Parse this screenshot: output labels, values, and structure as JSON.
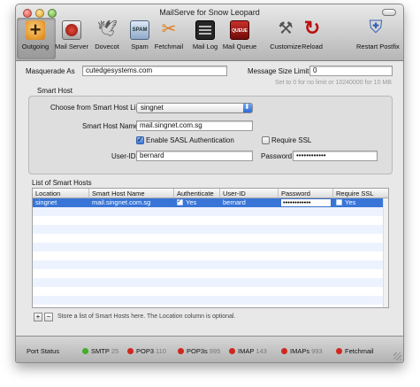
{
  "window": {
    "title": "MailServe for Snow Leopard"
  },
  "toolbar": {
    "items": [
      {
        "label": "Outgoing",
        "icon": "plus-icon"
      },
      {
        "label": "Mail Server",
        "icon": "mail-server-icon"
      },
      {
        "label": "Dovecot",
        "icon": "dove-icon"
      },
      {
        "label": "Spam",
        "icon": "spam-icon"
      },
      {
        "label": "Fetchmail",
        "icon": "fetchmail-icon"
      },
      {
        "label": "Mail Log",
        "icon": "log-icon"
      },
      {
        "label": "Mail Queue",
        "icon": "queue-icon"
      },
      {
        "label": "Customize",
        "icon": "tools-icon"
      },
      {
        "label": "Reload",
        "icon": "reload-icon"
      },
      {
        "label": "Restart Postfix",
        "icon": "shield-icon"
      }
    ],
    "selected": "Outgoing"
  },
  "masquerade": {
    "label": "Masquerade As",
    "value": "cutedgesystems.com"
  },
  "size_limit": {
    "label": "Message Size Limit",
    "value": "0",
    "hint": "Set to 0 for no limit or 10240000 for 10 MB"
  },
  "smart_host": {
    "group_label": "Smart Host",
    "choose_label": "Choose from Smart Host List",
    "choose_value": "singnet",
    "name_label": "Smart Host Name",
    "name_value": "mail.singnet.com.sg",
    "sasl_label": "Enable SASL Authentication",
    "sasl_checked": true,
    "ssl_label": "Require SSL",
    "ssl_checked": false,
    "userid_label": "User-ID",
    "userid_value": "bernard",
    "password_label": "Password",
    "password_value": "••••••••••••"
  },
  "hosts_list": {
    "label": "List of Smart Hosts",
    "columns": [
      "Location",
      "Smart Host Name",
      "Authenticate",
      "User-ID",
      "Password",
      "Require SSL"
    ],
    "rows": [
      {
        "location": "singnet",
        "host": "mail.singnet.com.sg",
        "authenticate": "Yes",
        "userid": "bernard",
        "password": "••••••••••••",
        "require_ssl": "Yes"
      }
    ],
    "add_label": "+",
    "remove_label": "−",
    "note": "Store a list of Smart Hosts here. The Location column is optional."
  },
  "status": {
    "label": "Port Status",
    "items": [
      {
        "name": "SMTP",
        "port": "25",
        "color": "#3fae2a"
      },
      {
        "name": "POP3",
        "port": "110",
        "color": "#d0271d"
      },
      {
        "name": "POP3s",
        "port": "995",
        "color": "#d0271d"
      },
      {
        "name": "IMAP",
        "port": "143",
        "color": "#d0271d"
      },
      {
        "name": "IMAPs",
        "port": "993",
        "color": "#d0271d"
      },
      {
        "name": "Fetchmail",
        "port": "",
        "color": "#d0271d"
      }
    ]
  }
}
